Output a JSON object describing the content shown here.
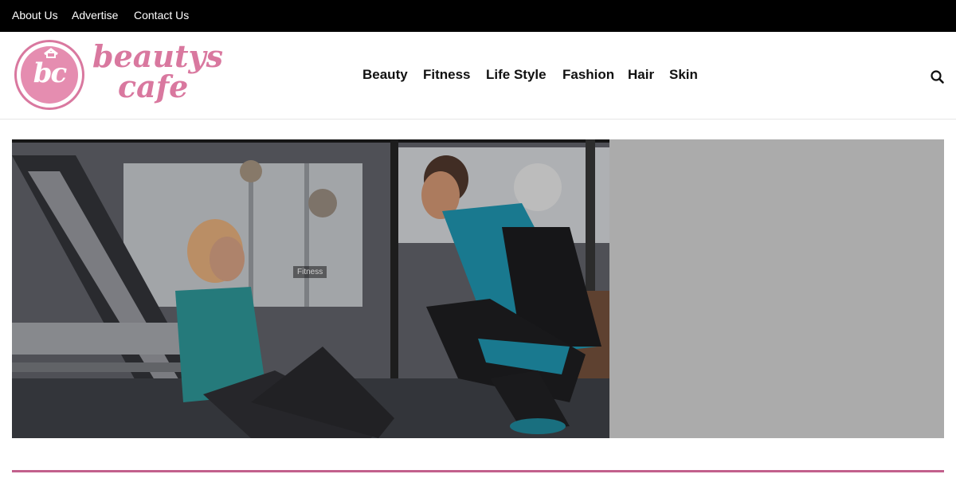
{
  "topbar": {
    "links": [
      "About Us",
      "Advertise",
      "Contact Us"
    ]
  },
  "logo": {
    "badge_text": "bc",
    "line1": "beautys",
    "line2": "cafe",
    "color": "#d9789f"
  },
  "nav": {
    "items": [
      "Beauty",
      "Fitness",
      "Life Style",
      "Fashion",
      "Hair",
      "Skin"
    ]
  },
  "search": {
    "icon": "search-icon"
  },
  "featured": {
    "category": "Fitness",
    "side_panel_color": "#ababab"
  },
  "colors": {
    "topbar": "#000000",
    "accent": "#c2608c"
  }
}
